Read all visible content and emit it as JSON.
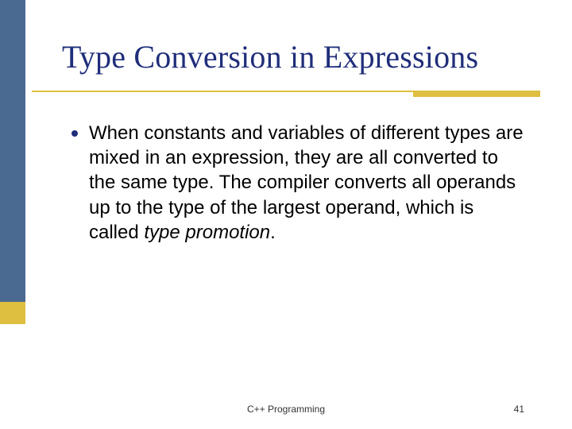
{
  "title": "Type Conversion in Expressions",
  "bullet": {
    "text_before": "When constants and variables of different types are mixed in an expression, they are all converted to the same type. The compiler converts all operands up to the type of the largest operand, which is called ",
    "emphasis": "type promotion",
    "text_after": "."
  },
  "footer": {
    "center": "C++ Programming",
    "page": "41"
  }
}
